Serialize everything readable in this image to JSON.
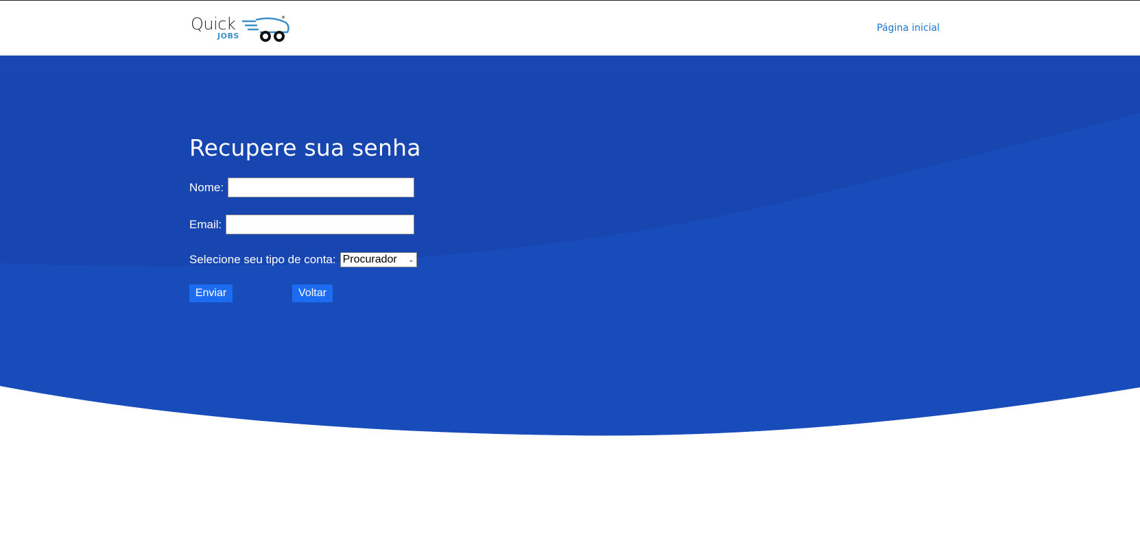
{
  "header": {
    "logo_primary": "Quick",
    "logo_secondary": "JOBS",
    "nav_home": "Página inicial"
  },
  "form": {
    "title": "Recupere sua senha",
    "name_label": "Nome:",
    "name_value": "",
    "email_label": "Email:",
    "email_value": "",
    "account_type_label": "Selecione seu tipo de conta:",
    "account_type_selected": "Procurador",
    "submit_label": "Enviar",
    "back_label": "Voltar"
  },
  "colors": {
    "hero_blue": "#1747b3",
    "button_blue": "#1b6cf0",
    "link_blue": "#1a75d1"
  }
}
